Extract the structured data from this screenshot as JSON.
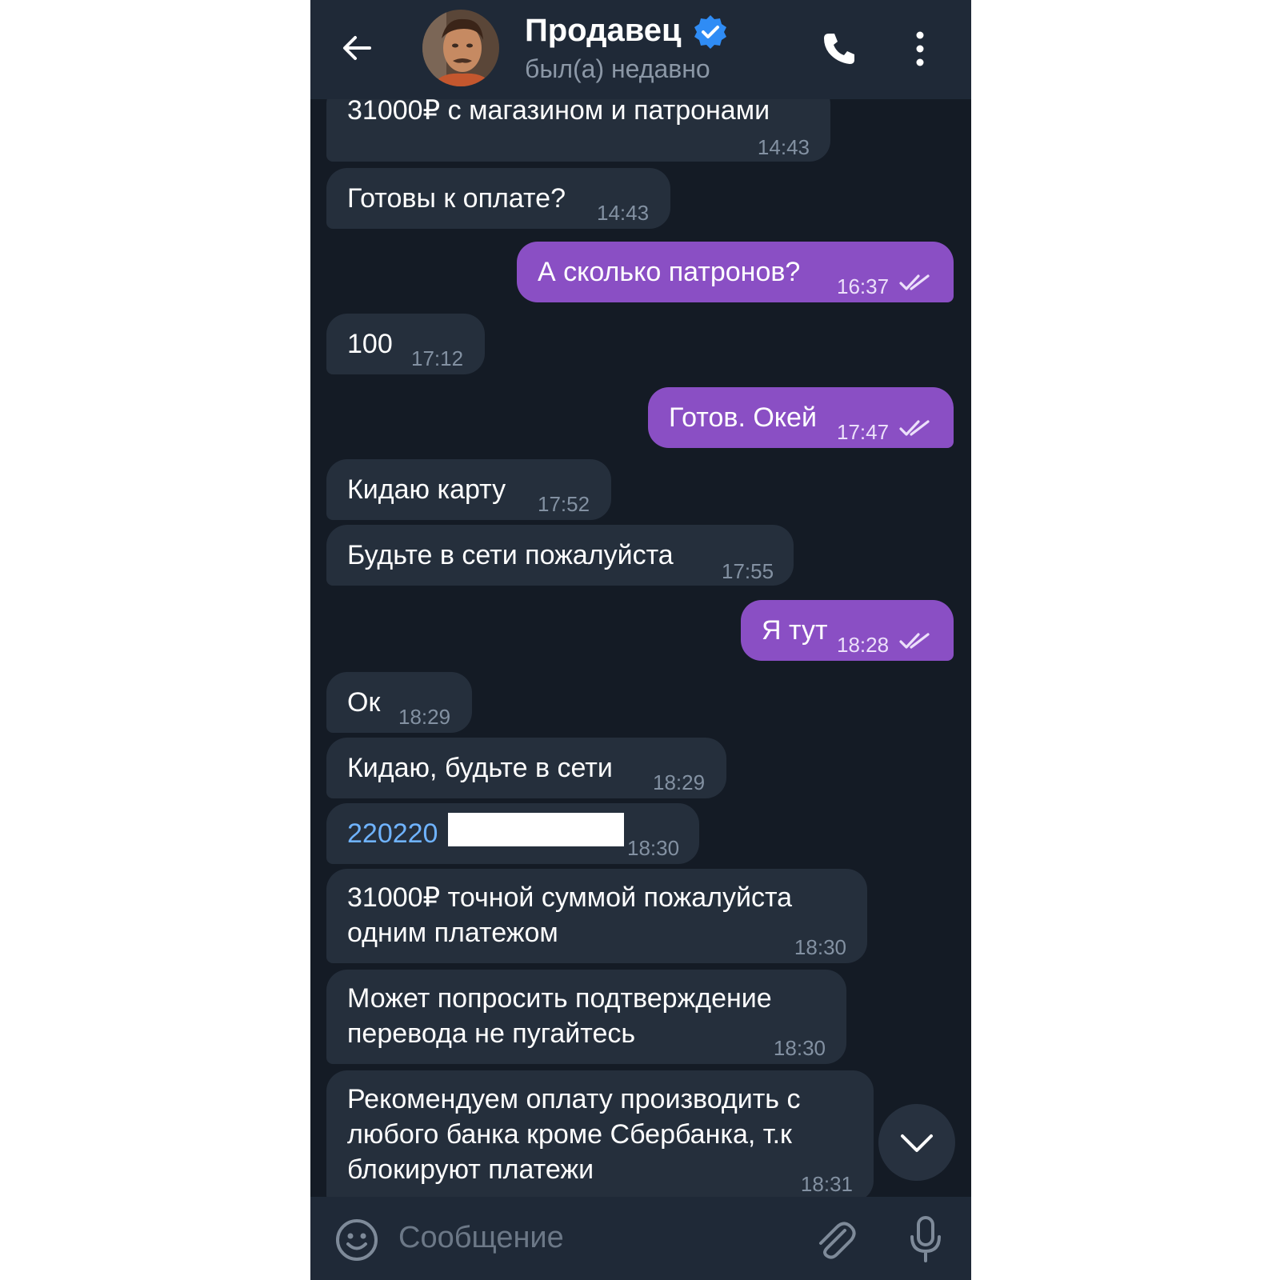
{
  "header": {
    "back_icon": "arrow-left-icon",
    "name": "Продавец",
    "verified_icon": "verified-badge-icon",
    "status": "был(а) недавно",
    "call_icon": "phone-icon",
    "menu_icon": "more-vertical-icon"
  },
  "messages": [
    {
      "dir": "in",
      "text": "31000₽ с магазином и патронами",
      "time": "14:43"
    },
    {
      "dir": "in",
      "text": "Готовы к оплате?",
      "time": "14:43"
    },
    {
      "dir": "out",
      "text": "А сколько патронов?",
      "time": "16:37"
    },
    {
      "dir": "in",
      "text": "100",
      "time": "17:12"
    },
    {
      "dir": "out",
      "text": "Готов. Окей",
      "time": "17:47"
    },
    {
      "dir": "in",
      "text": "Кидаю карту",
      "time": "17:52"
    },
    {
      "dir": "in",
      "text": "Будьте в сети пожалуйста",
      "time": "17:55"
    },
    {
      "dir": "out",
      "text": "Я тут",
      "time": "18:28"
    },
    {
      "dir": "in",
      "text": "Ок",
      "time": "18:29"
    },
    {
      "dir": "in",
      "text": "Кидаю, будьте в сети",
      "time": "18:29"
    },
    {
      "dir": "in",
      "text": "220220",
      "time": "18:30"
    },
    {
      "dir": "in",
      "line1": "31000₽ точной суммой пожалуйста",
      "line2": "одним платежом",
      "time": "18:30"
    },
    {
      "dir": "in",
      "line1": "Может попросить подтверждение",
      "line2": "перевода не пугайтесь",
      "time": "18:30"
    },
    {
      "dir": "in",
      "line1": "Рекомендуем оплату производить с",
      "line2": "любого банка кроме Сбербанка, т.к",
      "line3": "блокируют платежи",
      "time": "18:31"
    }
  ],
  "composer": {
    "placeholder": "Сообщение",
    "emoji_icon": "smile-icon",
    "attach_icon": "paperclip-icon",
    "mic_icon": "microphone-icon"
  },
  "scroll_icon": "chevron-down-icon",
  "colors": {
    "background": "#141b25",
    "header": "#1f2937",
    "incoming": "#252f3c",
    "outgoing": "#8a4fc4",
    "link": "#6fb3ff",
    "verified": "#2f8cf5"
  }
}
